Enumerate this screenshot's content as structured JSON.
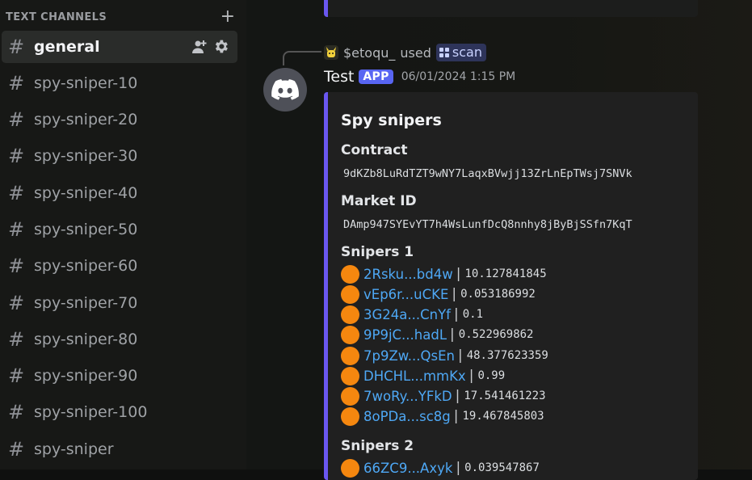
{
  "sidebar": {
    "category": "TEXT CHANNELS",
    "add_icon": "plus-icon",
    "channels": [
      {
        "name": "general"
      },
      {
        "name": "spy-sniper-10"
      },
      {
        "name": "spy-sniper-20"
      },
      {
        "name": "spy-sniper-30"
      },
      {
        "name": "spy-sniper-40"
      },
      {
        "name": "spy-sniper-50"
      },
      {
        "name": "spy-sniper-60"
      },
      {
        "name": "spy-sniper-70"
      },
      {
        "name": "spy-sniper-80"
      },
      {
        "name": "spy-sniper-90"
      },
      {
        "name": "spy-sniper-100"
      },
      {
        "name": "spy-sniper"
      }
    ],
    "hash": "#",
    "active_icons": [
      "add-member-icon",
      "gear-icon"
    ]
  },
  "message": {
    "reply": {
      "user": "$etoqu_",
      "used": "used",
      "command": "scan"
    },
    "author": "Test",
    "badge": "APP",
    "timestamp": "06/01/2024 1:15 PM",
    "embed": {
      "title": "Spy snipers",
      "contract_label": "Contract",
      "contract_value": "9dKZb8LuRdTZT9wNY7LaqxBVwjj13ZrLnEpTWsj7SNVk",
      "market_label": "Market ID",
      "market_value": "DAmp947SYEvYT7h4WsLunfDcQ8nnhy8jByBjSSfn7KqT",
      "snipers1_label": "Snipers 1",
      "snipers1": [
        {
          "addr": "2Rsku...bd4w",
          "amount": "10.127841845"
        },
        {
          "addr": "vEp6r...uCKE",
          "amount": "0.053186992"
        },
        {
          "addr": "3G24a...CnYf",
          "amount": "0.1"
        },
        {
          "addr": "9P9jC...hadL",
          "amount": "0.522969862"
        },
        {
          "addr": "7p9Zw...QsEn",
          "amount": "48.377623359"
        },
        {
          "addr": "DHCHL...mmKx",
          "amount": "0.99"
        },
        {
          "addr": "7woRy...YFkD",
          "amount": "17.541461223"
        },
        {
          "addr": "8oPDa...sc8g",
          "amount": "19.467845803"
        }
      ],
      "snipers2_label": "Snipers 2",
      "snipers2": [
        {
          "addr": "66ZC9...Axyk",
          "amount": "0.039547867"
        }
      ],
      "separator": "|"
    }
  },
  "colors": {
    "accent": "#6a57f0",
    "link": "#4ea8f5",
    "sniper_dot": "#f5870f",
    "badge": "#5865f2"
  }
}
